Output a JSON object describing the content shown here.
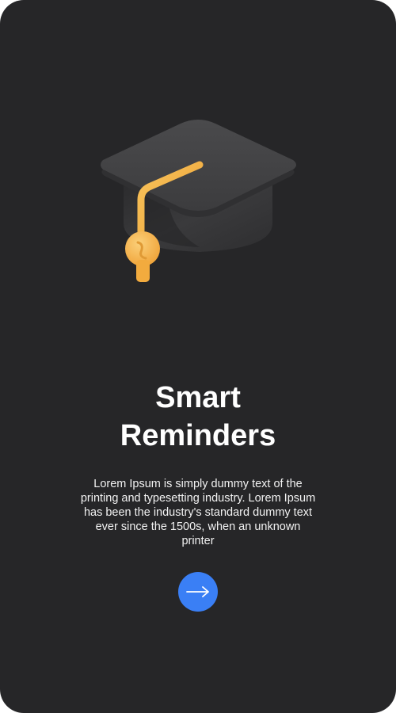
{
  "onboarding": {
    "title_line1": "Smart",
    "title_line2": "Reminders",
    "description": "Lorem Ipsum is simply dummy text of the printing and typesetting industry. Lorem Ipsum has been the industry's standard dummy text ever since the 1500s, when an unknown printer",
    "next_icon": "arrow-right-icon",
    "illustration_icon": "graduation-cap-icon"
  },
  "colors": {
    "background": "#262628",
    "accent": "#3a7ff5",
    "tassel": "#f5b642",
    "text": "#ffffff"
  }
}
